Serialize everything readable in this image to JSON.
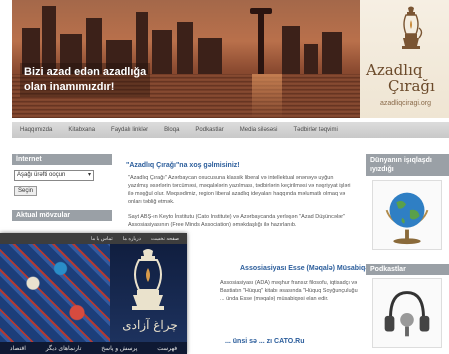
{
  "banner": {
    "slogan_line1": "Bizi azad edən azadlığa",
    "slogan_line2": "olan inamımızdır!",
    "brand_line1": "Azadlıq",
    "brand_line2": "Çırağı",
    "brand_url": "azadliqciragi.org"
  },
  "nav": {
    "items": [
      "Haqqımızda",
      "Kitabxana",
      "Faydalı linklər",
      "Bloqa",
      "Podkastlar",
      "Media siləsəsi",
      "Tədbirlər təqvimi"
    ]
  },
  "left": {
    "internet_title": "İnternet",
    "lang_select_value": "Aşağı ürəfti ooçun",
    "choose_button": "Seçin",
    "aktual_title": "Aktual mövzular"
  },
  "main": {
    "welcome": "\"Azadlıq Çırağı\"na xoş gəlmisiniz!",
    "intro": "\"Azadlıq Çırağı\" Azərbaycan oxucusuna klassik liberal və intellektual ənənəyə uyğun yazılmış əsərlərin tərcüməsi, məqalələrin yazılması, tədbirlərin keçirilməsi və nəşriyyat işləri ilə məşğul olur. Məqsədimiz, region liberal azadlıq ideyaları haqqında məlumatlı olmaq və onları təbliğ etmək.",
    "intro2": "Sayt ABŞ-ın Keyto İnstitutu (Cato Institute) və Azərbaycanda yerləşən \"Azad Düşüncələr\" Assosiasiyasının (Free Minds Association) əməkdaşlığı ilə hazırlanıb.",
    "essay_title": "Assosiasiyası Esse (Məqalə) Müsabiqəsi",
    "essay_body": "Assosiasiyası (ADA) məşhur fransız filosofu, iqtisadçı və Bastiatın \"Hüquq\" kitabı əsasında \"Hüquq Soyğunçuluğu ... ünda Esse (məqalə) müsabiqəsi elan edir.",
    "cato_link": "... ünsi sə ... zı CATO.Ru"
  },
  "right": {
    "ideas_title": "Dünyanın işıqlaşdı ıyızdığı",
    "podcast_title": "Podkastlar"
  },
  "overlay": {
    "bar_items": [
      "تماس با ما",
      "درباره ما",
      "صفحه نخست"
    ],
    "brand_text": "چراغ آزادی",
    "menu_items": [
      "فهرست",
      "پرسش و پاسخ",
      "تارنماهای دیگر",
      "اقتصاد"
    ]
  },
  "colors": {
    "accent_blue": "#2b5d9b",
    "nav_gray": "#c8c8c8",
    "overlay_navy": "#1b2c52"
  }
}
